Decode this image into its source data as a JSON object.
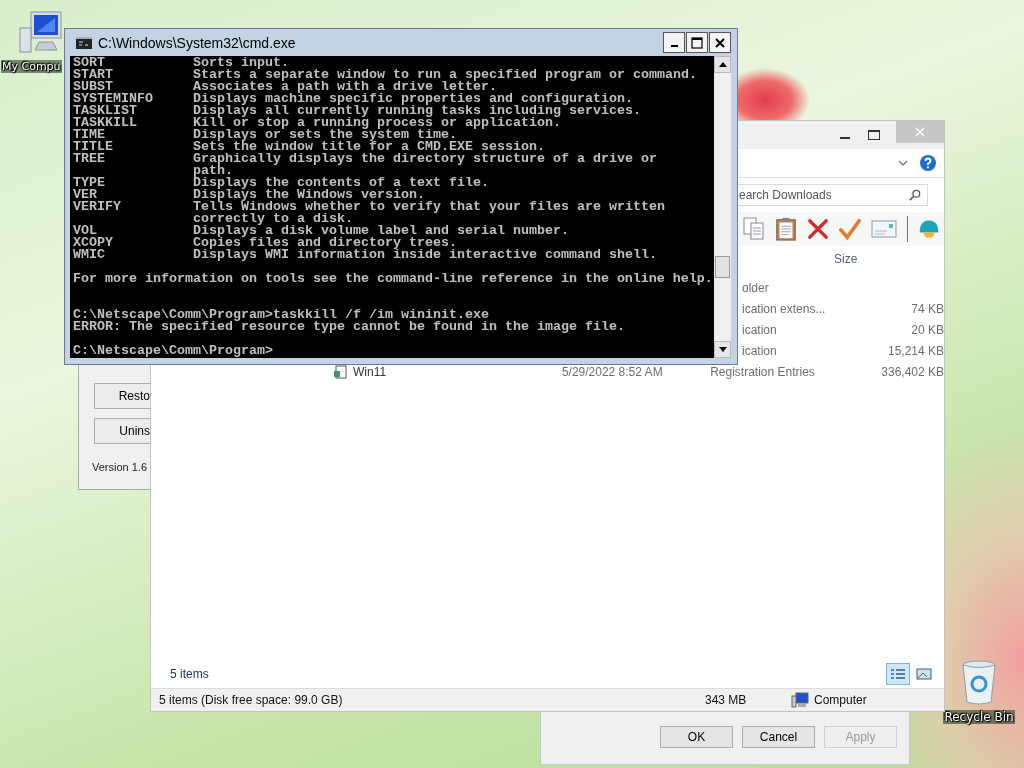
{
  "desktop": {
    "icons": [
      {
        "kind": "computer",
        "label": "My Compu"
      },
      {
        "kind": "recycle",
        "label": "Recycle Bin"
      }
    ]
  },
  "control_panel": {
    "buttons": [
      {
        "label": "Resto"
      },
      {
        "label": "Unins"
      }
    ],
    "version": "Version 1.6"
  },
  "dialog": {
    "buttons": [
      {
        "label": "OK",
        "disabled": false
      },
      {
        "label": "Cancel",
        "disabled": false
      },
      {
        "label": "Apply",
        "disabled": true
      }
    ]
  },
  "explorer_window": {
    "search": {
      "placeholder": "earch Downloads"
    },
    "columns": [
      {
        "label": "Size"
      }
    ],
    "rows": [
      {
        "kind": "covered",
        "type": "older"
      },
      {
        "kind": "covered",
        "type": "ication extens...",
        "size": "74 KB"
      },
      {
        "kind": "covered",
        "type": "ication",
        "size": "20 KB"
      },
      {
        "kind": "covered",
        "type": "ication",
        "size": "15,214 KB"
      },
      {
        "kind": "full",
        "name": "Win11",
        "date": "5/29/2022 8:52 AM",
        "type": "Registration Entries",
        "size": "336,402 KB"
      }
    ],
    "item_count": "5 items",
    "views": [
      {
        "kind": "details",
        "selected": true
      },
      {
        "kind": "preview",
        "selected": false
      }
    ],
    "status_bar": {
      "summary": "5 items (Disk free space: 99.0 GB)",
      "size": "343 MB",
      "location": "Computer"
    }
  },
  "cmd_window": {
    "title": "C:\\Windows\\System32\\cmd.exe",
    "help_entries": [
      {
        "command": "SORT",
        "description": [
          "Sorts input."
        ]
      },
      {
        "command": "START",
        "description": [
          "Starts a separate window to run a specified program or command."
        ]
      },
      {
        "command": "SUBST",
        "description": [
          "Associates a path with a drive letter."
        ]
      },
      {
        "command": "SYSTEMINFO",
        "description": [
          "Displays machine specific properties and configuration."
        ]
      },
      {
        "command": "TASKLIST",
        "description": [
          "Displays all currently running tasks including services."
        ]
      },
      {
        "command": "TASKKILL",
        "description": [
          "Kill or stop a running process or application."
        ]
      },
      {
        "command": "TIME",
        "description": [
          "Displays or sets the system time."
        ]
      },
      {
        "command": "TITLE",
        "description": [
          "Sets the window title for a CMD.EXE session."
        ]
      },
      {
        "command": "TREE",
        "description": [
          "Graphically displays the directory structure of a drive or",
          "path."
        ]
      },
      {
        "command": "TYPE",
        "description": [
          "Displays the contents of a text file."
        ]
      },
      {
        "command": "VER",
        "description": [
          "Displays the Windows version."
        ]
      },
      {
        "command": "VERIFY",
        "description": [
          "Tells Windows whether to verify that your files are written",
          "correctly to a disk."
        ]
      },
      {
        "command": "VOL",
        "description": [
          "Displays a disk volume label and serial number."
        ]
      },
      {
        "command": "XCOPY",
        "description": [
          "Copies files and directory trees."
        ]
      },
      {
        "command": "WMIC",
        "description": [
          "Displays WMI information inside interactive command shell."
        ]
      }
    ],
    "footer": "For more information on tools see the command-line reference in the online help.",
    "session": [
      {
        "command_line": "C:\\Netscape\\Comm\\Program>taskkill /f /im wininit.exe",
        "output": "ERROR: The specified resource type cannot be found in the image file."
      }
    ],
    "prompt": "C:\\Netscape\\Comm\\Program>"
  }
}
